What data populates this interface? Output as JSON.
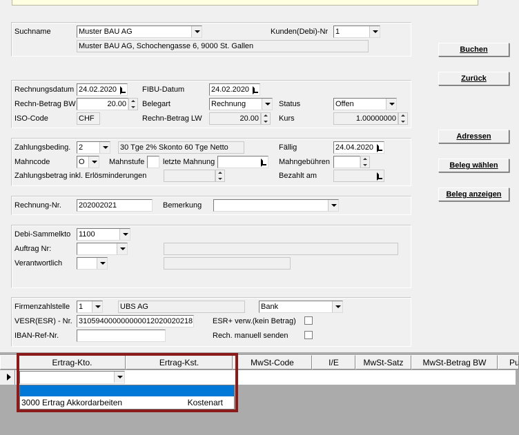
{
  "customer": {
    "suchname_label": "Suchname",
    "suchname_value": "Muster BAU AG",
    "kunden_nr_label": "Kunden(Debi)-Nr",
    "kunden_nr_value": "1",
    "address": "Muster BAU AG, Schochengasse 6, 9000 St. Gallen"
  },
  "invoice": {
    "rechnungsdatum_label": "Rechnungsdatum",
    "rechnungsdatum": "24.02.2020",
    "fibu_label": "FIBU-Datum",
    "fibu_datum": "24.02.2020",
    "betrag_bw_label": "Rechn-Betrag BW",
    "betrag_bw": "20.00",
    "belegart_label": "Belegart",
    "belegart": "Rechnung",
    "status_label": "Status",
    "status": "Offen",
    "iso_label": "ISO-Code",
    "iso": "CHF",
    "betrag_lw_label": "Rechn-Betrag LW",
    "betrag_lw": "20.00",
    "kurs_label": "Kurs",
    "kurs": "1.00000000"
  },
  "payment": {
    "zahlungsbed_label": "Zahlungsbeding.",
    "zahlungsbed": "2",
    "zahlungsbed_text": "30 Tge 2% Skonto 60 Tge Netto",
    "faellig_label": "Fällig",
    "faellig": "24.04.2020",
    "mahncode_label": "Mahncode",
    "mahncode": "O",
    "mahnstufe_label": "Mahnstufe",
    "letzte_mahnung_label": "letzte Mahnung",
    "mahngebuehren_label": "Mahngebühren",
    "zahlungsbetrag_label": "Zahlungsbetrag inkl. Erlösminderungen",
    "bezahlt_label": "Bezahlt am"
  },
  "reference": {
    "rechnung_nr_label": "Rechnung-Nr.",
    "rechnung_nr": "202002021",
    "bemerkung_label": "Bemerkung"
  },
  "accounting": {
    "debi_label": "Debi-Sammelkto",
    "debi": "1100",
    "auftrag_label": "Auftrag Nr:",
    "verantwortlich_label": "Verantwortlich"
  },
  "bank": {
    "firmenzahlstelle_label": "Firmenzahlstelle",
    "firmenzahlstelle": "1",
    "bank_name": "UBS AG",
    "bank_type": "Bank",
    "vesr_label": "VESR(ESR) - Nr.",
    "vesr": "310594000000000012020020218",
    "esr_label": "ESR+ verw.(kein Betrag)",
    "iban_label": "IBAN-Ref-Nr.",
    "manuell_label": "Rech. manuell senden"
  },
  "buttons": {
    "buchen": "Buchen",
    "zurueck": "Zurück",
    "adressen": "Adressen",
    "beleg_waehlen": "Beleg wählen",
    "beleg_anzeigen": "Beleg anzeigen"
  },
  "grid": {
    "columns": [
      "Ertrag-Kto.",
      "Ertrag-Kst.",
      "MwSt-Code",
      "I/E",
      "MwSt-Satz",
      "MwSt-Betrag BW",
      "Pu"
    ],
    "dropdown_item_left": "3000 Ertrag Akkordarbeiten",
    "dropdown_item_right": "Kostenart"
  },
  "colors": {
    "selection": "#0078d7",
    "highlight_border": "#8b1a1a"
  }
}
